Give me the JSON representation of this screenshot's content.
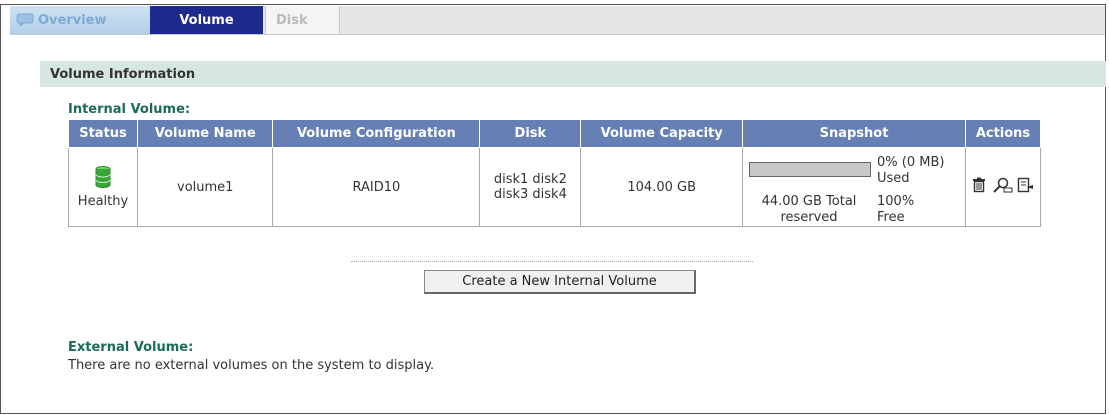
{
  "tabs": [
    {
      "label": "Overview"
    },
    {
      "label": "Volume"
    },
    {
      "label": "Disk"
    }
  ],
  "section_title": "Volume Information",
  "internal": {
    "title": "Internal Volume:",
    "columns": [
      "Status",
      "Volume Name",
      "Volume Configuration",
      "Disk",
      "Volume Capacity",
      "Snapshot",
      "Actions"
    ],
    "rows": [
      {
        "status": "Healthy",
        "status_icon": "database-green-icon",
        "name": "volume1",
        "configuration": "RAID10",
        "disk_line1": "disk1 disk2",
        "disk_line2": "disk3 disk4",
        "capacity": "104.00 GB",
        "snapshot": {
          "used_line1": "0% (0 MB)",
          "used_line2": "Used",
          "total_line1": "44.00 GB Total",
          "total_line2": "reserved",
          "free_line1": "100%",
          "free_line2": "Free",
          "used_fraction": 0
        },
        "actions": [
          "delete-icon",
          "search-icon",
          "edit-icon"
        ]
      }
    ]
  },
  "create_button": "Create a New Internal Volume",
  "external": {
    "title": "External Volume:",
    "message": "There are no external volumes on the system to display."
  },
  "colors": {
    "tab_active": "#1f2a8f",
    "header": "#6680b6",
    "section_bar": "#d6e7e2",
    "subtitle": "#1a6b5a",
    "healthy": "#3aa63a"
  }
}
